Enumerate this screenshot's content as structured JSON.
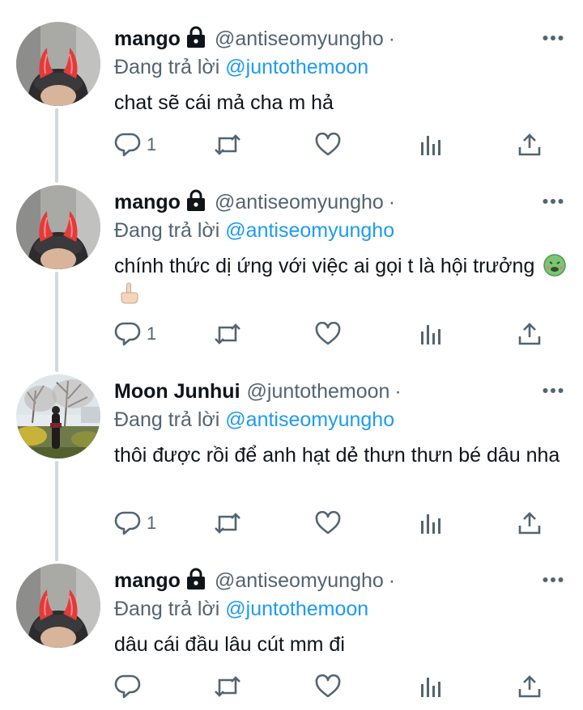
{
  "tweets": [
    {
      "name": "mango",
      "handle": "@antiseomyungho",
      "dot": "·",
      "replying_prefix": "Đang trả lời ",
      "replying_to": "@juntothemoon",
      "text": "chat sẽ cái mả cha m hả",
      "reply_count": "1",
      "avatar": "devil-horns-avatar",
      "locked": true
    },
    {
      "name": "mango",
      "handle": "@antiseomyungho",
      "dot": "·",
      "replying_prefix": "Đang trả lời ",
      "replying_to": "@antiseomyungho",
      "text": "chính thức dị ứng với việc ai gọi t là hội trưởng",
      "emojis": [
        "nauseated-face-emoji",
        "middle-finger-emoji"
      ],
      "reply_count": "1",
      "avatar": "devil-horns-avatar",
      "locked": true
    },
    {
      "name": "Moon Junhui",
      "handle": "@juntothemoon",
      "dot": "·",
      "replying_prefix": "Đang trả lời ",
      "replying_to": "@antiseomyungho",
      "text": "thôi được rồi để anh hạt dẻ thưn thưn bé dâu nha",
      "reply_count": "1",
      "avatar": "outdoor-tree-avatar",
      "locked": false
    },
    {
      "name": "mango",
      "handle": "@antiseomyungho",
      "dot": "·",
      "replying_prefix": "Đang trả lời ",
      "replying_to": "@juntothemoon",
      "text": "dâu cái đầu lâu cút mm đi",
      "reply_count": "",
      "avatar": "devil-horns-avatar",
      "locked": true
    }
  ],
  "icons": [
    "reply-icon",
    "retweet-icon",
    "like-icon",
    "analytics-icon",
    "share-icon",
    "more-icon",
    "lock-icon"
  ],
  "colors": {
    "accent": "#1d9bf0",
    "secondary_text": "#536471",
    "thread_line": "#cfd9de"
  }
}
